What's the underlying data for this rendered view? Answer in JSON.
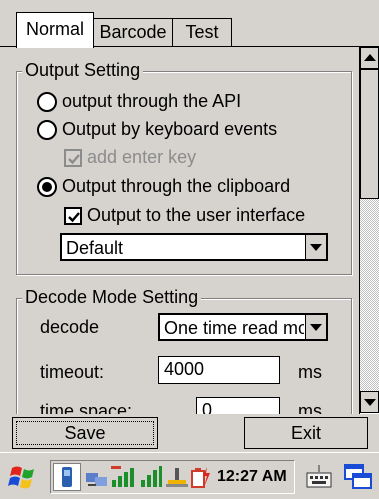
{
  "tabs": [
    {
      "label": "Normal",
      "active": true
    },
    {
      "label": "Barcode",
      "active": false
    },
    {
      "label": "Test",
      "active": false
    }
  ],
  "output_setting": {
    "legend": "Output Setting",
    "options": [
      {
        "label": "output through the API",
        "selected": false
      },
      {
        "label": "Output by keyboard events",
        "selected": false
      },
      {
        "label": "Output through the clipboard",
        "selected": true
      }
    ],
    "add_enter_key": {
      "label": "add enter key",
      "checked": true,
      "enabled": false
    },
    "output_to_ui": {
      "label": "Output to the user interface",
      "checked": true
    },
    "output_combo_value": "Default"
  },
  "decode_mode": {
    "legend": "Decode Mode Setting",
    "decode_label": "decode",
    "decode_value": "One time read mode",
    "timeout_label": "timeout:",
    "timeout_value": "4000",
    "timeout_unit": "ms",
    "timespace_label": "time space:",
    "timespace_value": "0",
    "timespace_unit": "ms"
  },
  "buttons": {
    "save": "Save",
    "exit": "Exit"
  },
  "taskbar": {
    "time": "12:27 AM"
  },
  "colors": {
    "chrome": "#d6d3ce",
    "start_red": "#e0231b",
    "start_green": "#21a32b",
    "start_blue": "#1a4bd6",
    "start_yellow": "#f3c21a"
  }
}
